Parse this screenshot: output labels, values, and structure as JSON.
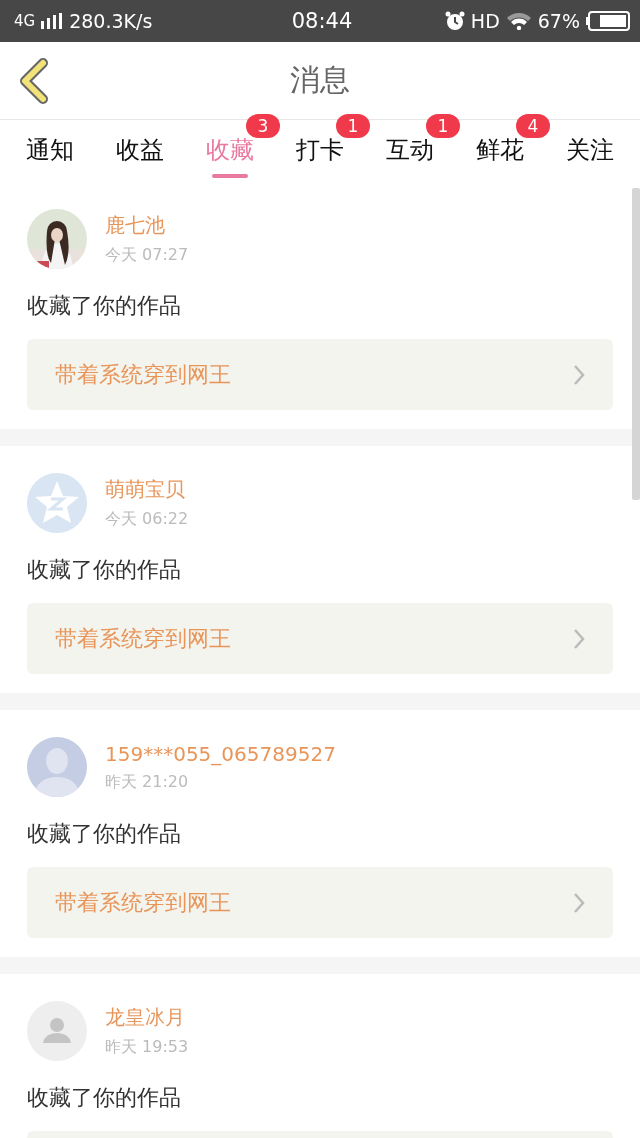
{
  "status_bar": {
    "network": "4G",
    "speed": "280.3K/s",
    "time": "08:44",
    "hd": "HD",
    "battery": "67%"
  },
  "header": {
    "title": "消息"
  },
  "tabs": [
    {
      "label": "通知",
      "selected": false
    },
    {
      "label": "收益",
      "selected": false
    },
    {
      "label": "收藏",
      "selected": true,
      "badge": "3"
    },
    {
      "label": "打卡",
      "selected": false,
      "badge": "1"
    },
    {
      "label": "互动",
      "selected": false,
      "badge": "1"
    },
    {
      "label": "鲜花",
      "selected": false,
      "badge": "4"
    },
    {
      "label": "关注",
      "selected": false
    }
  ],
  "messages": [
    {
      "kind": "picture",
      "name": "鹿七池",
      "time": "今天 07:27",
      "text": "收藏了你的作品",
      "work_title": "带着系统穿到网王"
    },
    {
      "kind": "star",
      "name": "萌萌宝贝",
      "time": "今天 06:22",
      "text": "收藏了你的作品",
      "work_title": "带着系统穿到网王"
    },
    {
      "kind": "person",
      "name": "159***055_065789527",
      "time": "昨天 21:20",
      "text": "收藏了你的作品",
      "work_title": "带着系统穿到网王"
    },
    {
      "kind": "default",
      "name": "龙皇冰月",
      "time": "昨天 19:53",
      "text": "收藏了你的作品"
    }
  ]
}
